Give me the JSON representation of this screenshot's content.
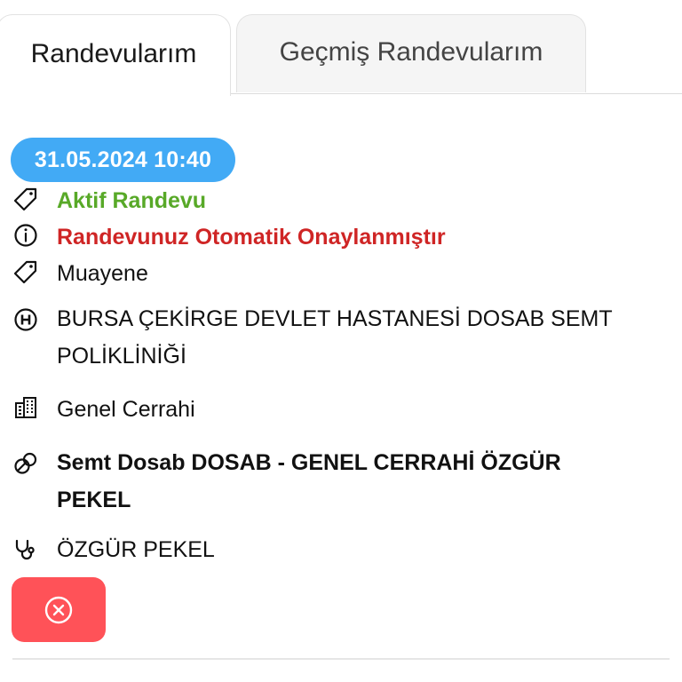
{
  "tabs": [
    {
      "label": "Randevularım",
      "active": true
    },
    {
      "label": "Geçmiş Randevularım",
      "active": false
    }
  ],
  "appointment": {
    "datetime": "31.05.2024 10:40",
    "status": "Aktif Randevu",
    "confirmation": "Randevunuz Otomatik Onaylanmıştır",
    "type": "Muayene",
    "hospital": "BURSA ÇEKİRGE DEVLET HASTANESİ DOSAB SEMT POLİKLİNİĞİ",
    "department": "Genel Cerrahi",
    "clinic": "Semt Dosab DOSAB - GENEL CERRAHİ ÖZGÜR PEKEL",
    "doctor": "ÖZGÜR PEKEL"
  },
  "colors": {
    "badge": "#42aaf5",
    "status_green": "#58a928",
    "confirm_red": "#cf2525",
    "cancel_button": "#ff5258"
  },
  "icons": {
    "status": "tag-icon",
    "confirmation": "info-circle-icon",
    "type": "tag-icon",
    "hospital": "hospital-h-icon",
    "department": "building-icon",
    "clinic": "pills-icon",
    "doctor": "stethoscope-icon",
    "cancel": "close-circle-icon"
  }
}
